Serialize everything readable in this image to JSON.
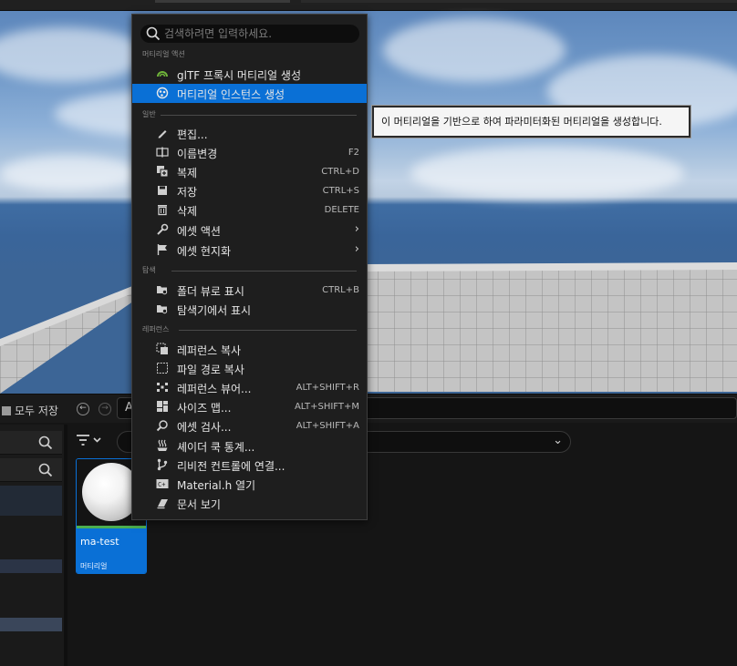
{
  "toolbar": {
    "save_all_label": "모두 저장",
    "path_text": "A                                                                                      al"
  },
  "asset_grid": {
    "tile": {
      "name": "ma-test",
      "type": "머티리얼"
    }
  },
  "context_menu": {
    "search_placeholder": "검색하려면 입력하세요.",
    "sections": {
      "material_actions": "머티리얼 액션",
      "common": "일반",
      "explore": "탐색",
      "references": "레퍼런스"
    },
    "items": {
      "gltf_proxy": {
        "label": "glTF 프록시 머티리얼 생성"
      },
      "create_instance": {
        "label": "머티리얼 인스턴스 생성"
      },
      "edit": {
        "label": "편집..."
      },
      "rename": {
        "label": "이름변경",
        "shortcut": "F2"
      },
      "duplicate": {
        "label": "복제",
        "shortcut": "CTRL+D"
      },
      "save": {
        "label": "저장",
        "shortcut": "CTRL+S"
      },
      "delete": {
        "label": "삭제",
        "shortcut": "DELETE"
      },
      "asset_actions": {
        "label": "에셋 액션"
      },
      "asset_localization": {
        "label": "에셋 현지화"
      },
      "show_in_folder_view": {
        "label": "폴더 뷰로 표시",
        "shortcut": "CTRL+B"
      },
      "show_in_explorer": {
        "label": "탐색기에서 표시"
      },
      "copy_reference": {
        "label": "레퍼런스 복사"
      },
      "copy_file_path": {
        "label": "파일 경로 복사"
      },
      "reference_viewer": {
        "label": "레퍼런스 뷰어...",
        "shortcut": "ALT+SHIFT+R"
      },
      "size_map": {
        "label": "사이즈 맵...",
        "shortcut": "ALT+SHIFT+M"
      },
      "audit_assets": {
        "label": "에셋 검사...",
        "shortcut": "ALT+SHIFT+A"
      },
      "shader_cook_stats": {
        "label": "셰이더 쿡 통계..."
      },
      "connect_source_control": {
        "label": "리비전 컨트롤에 연결..."
      },
      "open_material_h": {
        "label": "Material.h 열기"
      },
      "view_documentation": {
        "label": "문서 보기"
      }
    }
  },
  "tooltip": {
    "text": "이 머티리얼을 기반으로 하여 파라미터화된 머티리얼을 생성합니다."
  },
  "colors": {
    "accent": "#0a70d6",
    "menu_bg": "#1e1e1e",
    "tooltip_bg": "#f5f5f5"
  },
  "icons": [
    "search-icon",
    "gltf-icon",
    "material-instance-icon",
    "pencil-icon",
    "rename-icon",
    "duplicate-icon",
    "save-icon",
    "trash-icon",
    "wrench-icon",
    "flag-icon",
    "folder-icon",
    "folder-search-icon",
    "copy-reference-icon",
    "copy-path-icon",
    "reference-viewer-icon",
    "size-map-icon",
    "audit-icon",
    "steam-icon",
    "branch-icon",
    "code-icon",
    "book-icon",
    "chevron-right-icon",
    "filter-icon",
    "chevron-down-icon"
  ]
}
